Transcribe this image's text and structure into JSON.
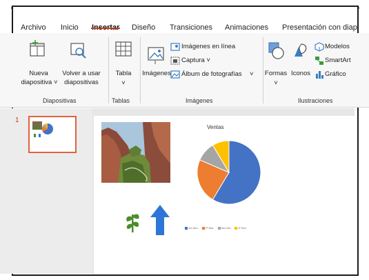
{
  "tabs": [
    {
      "label": "Archivo"
    },
    {
      "label": "Inicio"
    },
    {
      "label": "Insertar"
    },
    {
      "label": "Diseño"
    },
    {
      "label": "Transiciones"
    },
    {
      "label": "Animaciones"
    },
    {
      "label": "Presentación con diap"
    }
  ],
  "active_tab_index": 2,
  "ribbon": {
    "diapositivas": {
      "new_slide_line1": "Nueva",
      "new_slide_line2": "diapositiva ˅",
      "reuse_line1": "Volver a usar",
      "reuse_line2": "diapositivas",
      "group_label": "Diapositivas"
    },
    "tablas": {
      "table_label": "Tabla",
      "table_arrow": "˅",
      "group_label": "Tablas"
    },
    "imagenes": {
      "images_label": "Imágenes",
      "online_images": "Imágenes en línea",
      "screenshot": "Captura ˅",
      "photo_album": "Álbum de fotografías",
      "photo_album_arrow": "˅",
      "group_label": "Imágenes"
    },
    "ilustraciones": {
      "shapes_label": "Formas",
      "shapes_arrow": "˅",
      "icons_label": "Iconos",
      "models": "Modelos",
      "smartart": "SmartArt",
      "chart": "Gráfico",
      "group_label": "Ilustraciones"
    }
  },
  "slide_pane": {
    "slide_number": "1"
  },
  "slide": {
    "chart_title": "Ventas",
    "legend": [
      "1er trim.",
      "2º trim.",
      "3er trim.",
      "4º trim."
    ]
  },
  "colors": {
    "accent": "#c43e1c",
    "pie_blue": "#4472c4",
    "pie_orange": "#ed7d31",
    "pie_gray": "#a5a5a5",
    "pie_yellow": "#ffc000",
    "arrow_blue": "#2e75d6",
    "plant_green": "#4c8c2b"
  },
  "chart_data": {
    "type": "pie",
    "title": "Ventas",
    "categories": [
      "1er trim.",
      "2º trim.",
      "3er trim.",
      "4º trim."
    ],
    "values": [
      8.2,
      3.2,
      1.4,
      1.2
    ],
    "colors": [
      "#4472c4",
      "#ed7d31",
      "#a5a5a5",
      "#ffc000"
    ]
  }
}
